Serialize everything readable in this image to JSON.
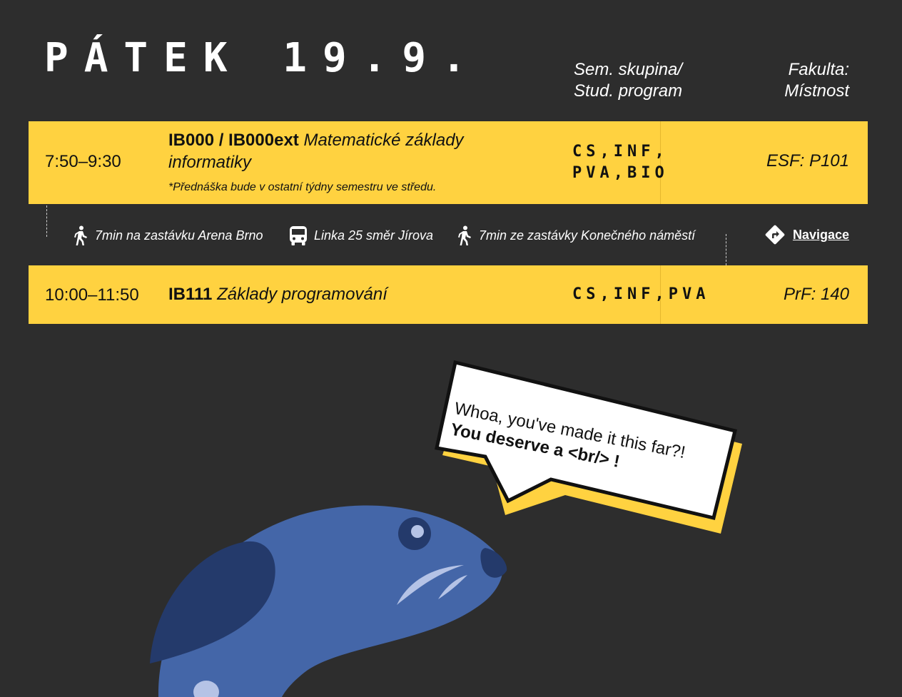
{
  "header": {
    "day_title": "PÁTEK 19.9.",
    "group_header": [
      "Sem. skupina/",
      "Stud. program"
    ],
    "room_header": [
      "Fakulta:",
      "Místnost"
    ]
  },
  "lectures": [
    {
      "time": "7:50–9:30",
      "code": "IB000 / IB000ext",
      "name": "Matematické základy informatiky",
      "note": "*Přednáška bude v ostatní týdny semestru ve středu.",
      "groups": [
        "CS,INF,",
        "PVA,BIO"
      ],
      "room": "ESF: P101"
    },
    {
      "time": "10:00–11:50",
      "code": "IB111",
      "name": "Základy programování",
      "groups": [
        "CS,INF,PVA"
      ],
      "room": "PrF: 140"
    }
  ],
  "transit": {
    "steps": [
      {
        "icon": "walk-icon",
        "text": "7min na zastávku Arena Brno"
      },
      {
        "icon": "bus-icon",
        "text": "Linka 25 směr Jírova"
      },
      {
        "icon": "walk-icon",
        "text": "7min ze zastávky Konečného náměstí"
      }
    ],
    "nav_icon": "directions-icon",
    "nav_label": "Navigace"
  },
  "speech_bubble": {
    "line1": "Whoa, you've made it this far?!",
    "line2": "You deserve a <br/> !"
  },
  "colors": {
    "background": "#2d2d2d",
    "accent_yellow": "#ffd240",
    "mascot_blue": "#4466a8",
    "mascot_dark_blue": "#243a6b",
    "text_dark": "#111111"
  }
}
